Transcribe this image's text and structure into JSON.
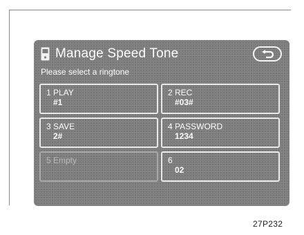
{
  "header": {
    "title": "Manage Speed Tone",
    "phone_icon": "mobile-phone-icon",
    "back_icon": "return-arrow-icon"
  },
  "prompt": "Please select a ringtone",
  "buttons": [
    {
      "label": "1 PLAY",
      "value": "#1"
    },
    {
      "label": "2 REC",
      "value": "#03#"
    },
    {
      "label": "3 SAVE",
      "value": "2#"
    },
    {
      "label": "4 PASSWORD",
      "value": "1234"
    },
    {
      "label": "5 Empty",
      "value": ""
    },
    {
      "label": "6",
      "value": "02"
    }
  ],
  "figure_ref": "27P232",
  "colors": {
    "screen_background": "#7d7d7d",
    "text": "#ffffff",
    "button_border": "#eaeaea"
  }
}
